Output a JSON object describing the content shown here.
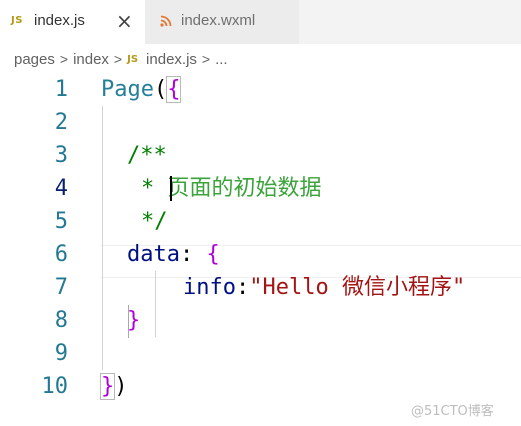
{
  "tabs": [
    {
      "icon": "js-icon",
      "icon_text": "JS",
      "label": "index.js",
      "active": true,
      "close": "×"
    },
    {
      "icon": "rss-icon",
      "label": "index.wxml",
      "active": false
    }
  ],
  "breadcrumb": {
    "items": [
      "pages",
      "index",
      "index.js",
      "..."
    ],
    "js_icon_text": "JS",
    "separator": ">"
  },
  "editor": {
    "line_numbers": [
      "1",
      "2",
      "3",
      "4",
      "5",
      "6",
      "7",
      "8",
      "9",
      "10"
    ],
    "active_line": "4",
    "lines": {
      "l1_fn": "Page",
      "l1_paren": "(",
      "l1_brace": "{",
      "l3": "/**",
      "l4_star": "* ",
      "l4_text": "页面的初始数据",
      "l5": "*/",
      "l6_key": "data",
      "l6_colon": ": ",
      "l6_brace": "{",
      "l7_key": "info",
      "l7_colon": ":",
      "l7_string": "\"Hello 微信小程序\"",
      "l8_brace": "}",
      "l10_brace": "}",
      "l10_paren": ")"
    }
  },
  "watermark": "@51CTO博客",
  "colors": {
    "line_number": "#237893",
    "active_line_number": "#0b216f",
    "function": "#267f99",
    "comment": "#008000",
    "key": "#001080",
    "string": "#a31515",
    "brace": "#af00db"
  }
}
